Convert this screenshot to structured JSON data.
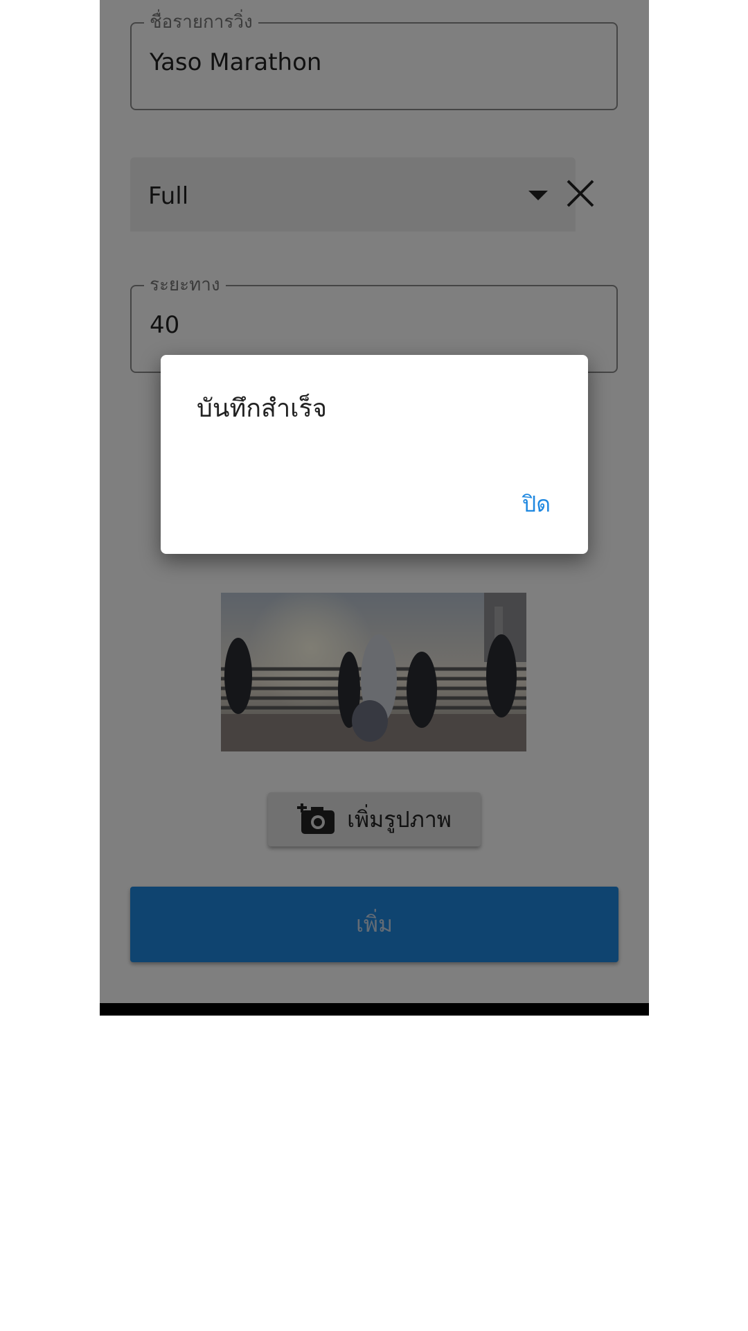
{
  "form": {
    "race_name": {
      "label": "ชื่อรายการวิ่ง",
      "value": "Yaso Marathon"
    },
    "race_type": {
      "selected": "Full"
    },
    "distance": {
      "label": "ระยะทาง",
      "value": "40"
    },
    "add_photo_label": "เพิ่มรูปภาพ",
    "submit_label": "เพิ่ม"
  },
  "dialog": {
    "title": "บันทึกสำเร็จ",
    "close_label": "ปิด"
  },
  "icons": {
    "dropdown": "arrow-drop-down-icon",
    "clear": "close-icon",
    "add_photo": "add-a-photo-icon"
  },
  "colors": {
    "primary": "#1f88e0",
    "scrim": "rgba(0,0,0,0.5)"
  }
}
